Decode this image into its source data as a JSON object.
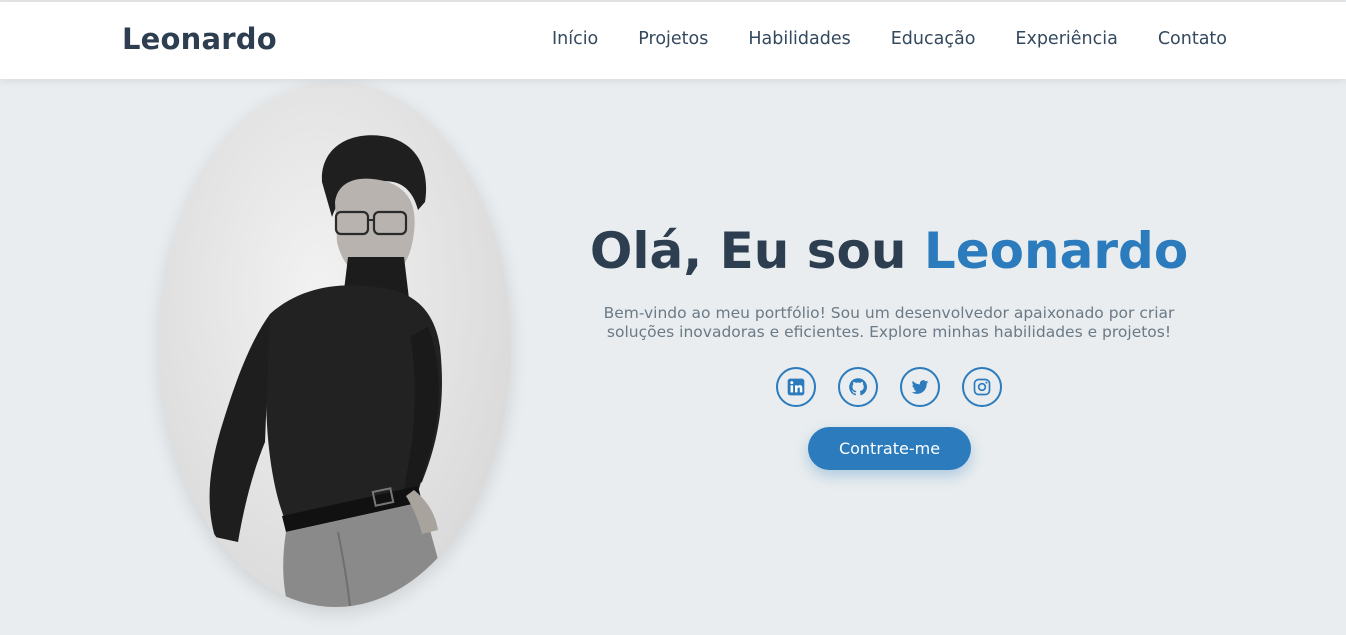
{
  "header": {
    "brand": "Leonardo",
    "nav": [
      "Início",
      "Projetos",
      "Habilidades",
      "Educação",
      "Experiência",
      "Contato"
    ]
  },
  "hero": {
    "greeting": "Olá, Eu sou",
    "name": "Leonardo",
    "description": "Bem-vindo ao meu portfólio! Sou um desenvolvedor apaixonado por criar soluções inovadoras e eficientes. Explore minhas habilidades e projetos!",
    "cta_label": "Contrate-me",
    "portrait_alt": "Leonardo",
    "socials": [
      "linkedin-icon",
      "github-icon",
      "twitter-icon",
      "instagram-icon"
    ]
  },
  "colors": {
    "accent": "#2b7bbd",
    "heading": "#2c3e50",
    "background": "#e9edef"
  }
}
